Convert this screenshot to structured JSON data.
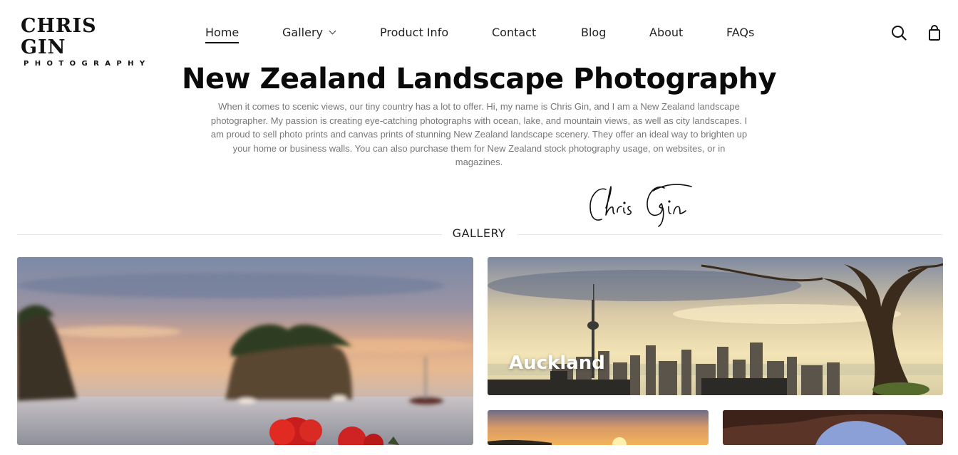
{
  "logo": {
    "main": "CHRIS GIN",
    "sub": "PHOTOGRAPHY"
  },
  "nav": {
    "items": [
      {
        "label": "Home",
        "active": true
      },
      {
        "label": "Gallery",
        "has_dropdown": true
      },
      {
        "label": "Product Info"
      },
      {
        "label": "Contact"
      },
      {
        "label": "Blog"
      },
      {
        "label": "About"
      },
      {
        "label": "FAQs"
      }
    ]
  },
  "icons": {
    "search": "search-icon",
    "cart": "shopping-bag-icon"
  },
  "intro": {
    "title": "New Zealand Landscape Photography",
    "paragraph": "When it comes to scenic views, our tiny country has a lot to offer. Hi, my name is Chris Gin, and I am a New Zealand landscape photographer. My passion is creating eye-catching photographs with ocean, lake, and mountain views, as well as city landscapes. I am proud to sell photo prints and canvas prints of stunning New Zealand landscape scenery. They offer an ideal way to brighten up your home or business walls. You can also purchase them for New Zealand stock photography usage, on websites, or in magazines.",
    "signature": "Chris Gin"
  },
  "gallery": {
    "heading": "GALLERY",
    "tiles": [
      {
        "label": ""
      },
      {
        "label": "Auckland"
      },
      {
        "label": ""
      },
      {
        "label": ""
      }
    ]
  },
  "colors": {
    "text": "#111111",
    "muted": "#777777",
    "divider": "#e6e6e6"
  }
}
